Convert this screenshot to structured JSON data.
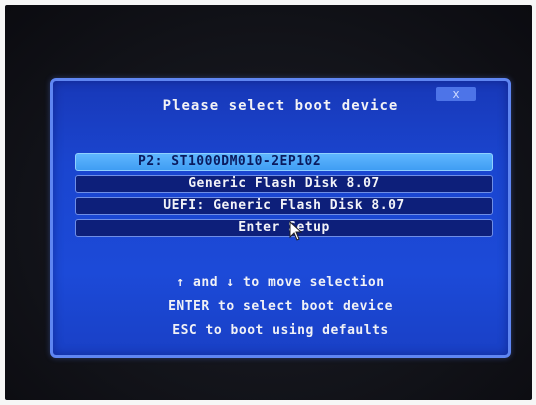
{
  "dialog": {
    "title": "Please select boot device",
    "close_label": "x"
  },
  "boot_devices": [
    {
      "label": "P2: ST1000DM010-2EP102",
      "selected": true
    },
    {
      "label": "Generic Flash Disk 8.07",
      "selected": false
    },
    {
      "label": "UEFI: Generic Flash Disk 8.07",
      "selected": false
    },
    {
      "label": "Enter Setup",
      "selected": false
    }
  ],
  "hints": [
    "↑ and ↓ to move selection",
    "ENTER to select boot device",
    "ESC to boot using defaults"
  ],
  "colors": {
    "dialog_bg": "#1c4ad8",
    "dialog_border": "#5f86f2",
    "item_bg": "#0d1f7a",
    "selected_bg": "#3f9df3",
    "text": "#f2f3f8"
  },
  "icons": {
    "cursor": "mouse-pointer-icon",
    "close": "close-icon"
  }
}
